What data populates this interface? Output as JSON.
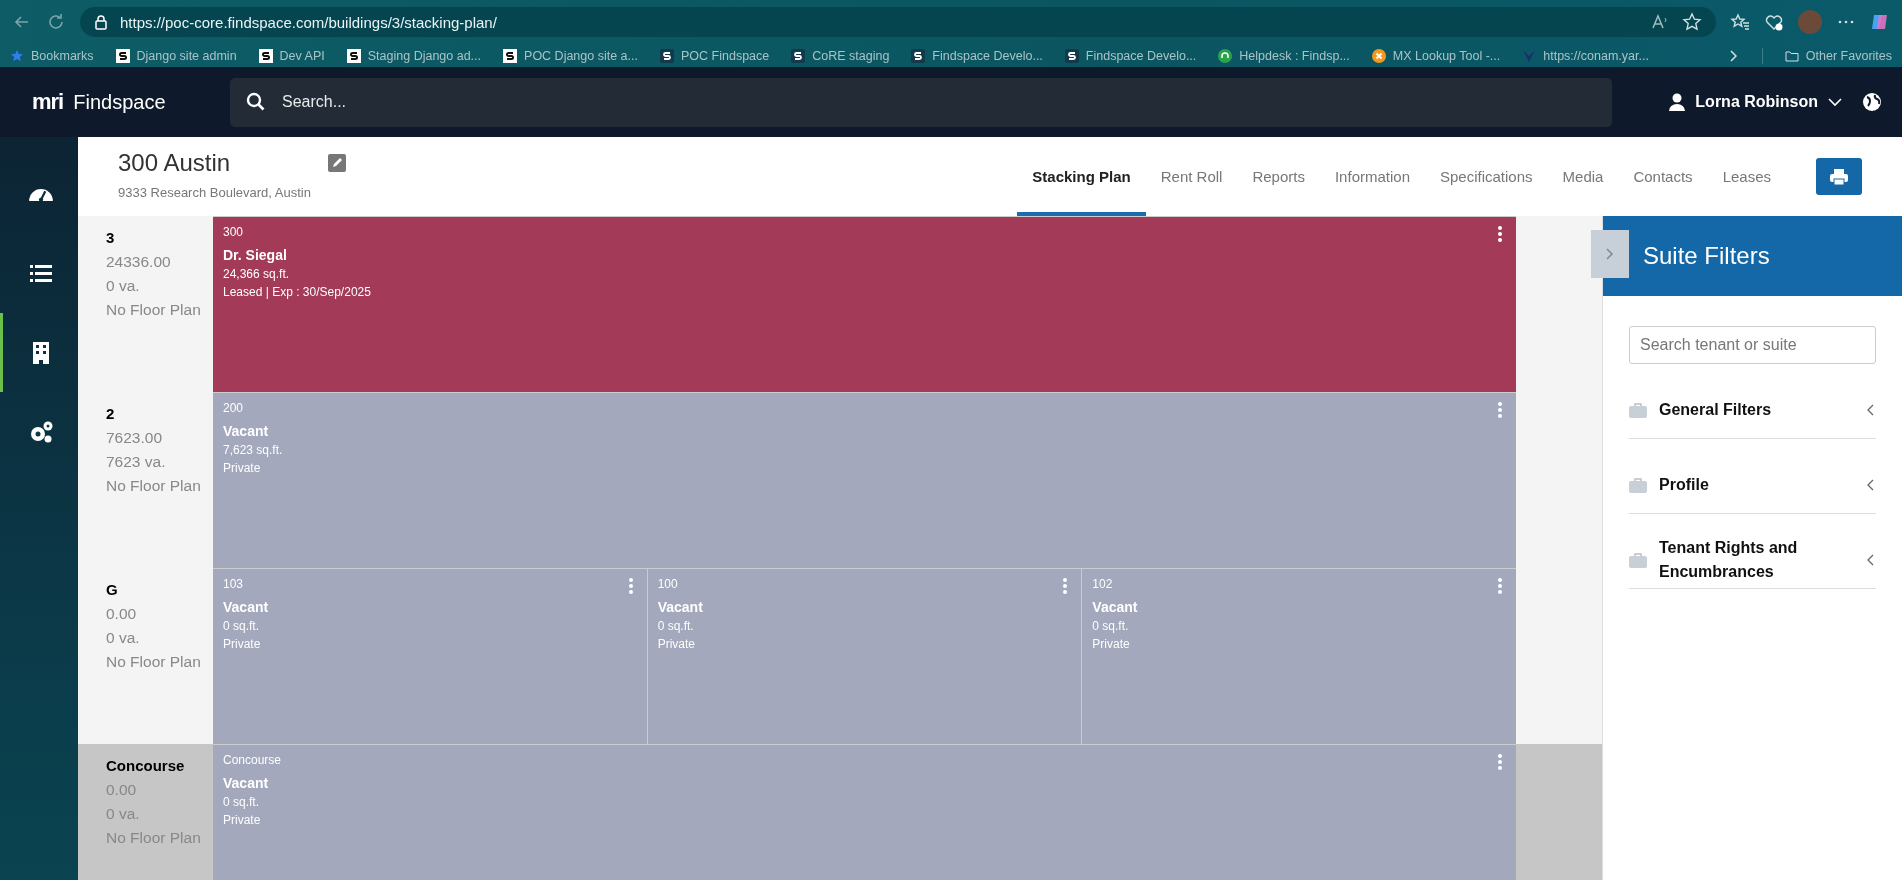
{
  "browser": {
    "url": "https://poc-core.findspace.com/buildings/3/stacking-plan/",
    "bookmarks": [
      {
        "kind": "star",
        "label": "Bookmarks"
      },
      {
        "kind": "django",
        "label": "Django site admin"
      },
      {
        "kind": "django",
        "label": "Dev API"
      },
      {
        "kind": "django",
        "label": "Staging Django ad..."
      },
      {
        "kind": "django",
        "label": "POC Django site a..."
      },
      {
        "kind": "findspace",
        "label": "POC Findspace"
      },
      {
        "kind": "findspace",
        "label": "CoRE staging"
      },
      {
        "kind": "findspace",
        "label": "Findspace Develo..."
      },
      {
        "kind": "findspace",
        "label": "Findspace Develo..."
      },
      {
        "kind": "helpdesk",
        "label": "Helpdesk : Findsp..."
      },
      {
        "kind": "mx",
        "label": "MX Lookup Tool -..."
      },
      {
        "kind": "conam",
        "label": "https://conam.yar..."
      }
    ],
    "other_favorites": "Other Favorites"
  },
  "app": {
    "logo": "mri",
    "product": "Findspace",
    "search": {
      "placeholder": "Search..."
    },
    "user": "Lorna Robinson"
  },
  "nav": [
    {
      "kind": "gauge",
      "selected": false
    },
    {
      "kind": "list",
      "selected": false
    },
    {
      "kind": "building",
      "selected": true
    },
    {
      "kind": "gears",
      "selected": false
    }
  ],
  "building": {
    "name": "300 Austin",
    "address": "9333 Research Boulevard, Austin"
  },
  "tabs": [
    {
      "label": "Stacking Plan",
      "selected": true
    },
    {
      "label": "Rent Roll",
      "selected": false
    },
    {
      "label": "Reports",
      "selected": false
    },
    {
      "label": "Information",
      "selected": false
    },
    {
      "label": "Specifications",
      "selected": false
    },
    {
      "label": "Media",
      "selected": false
    },
    {
      "label": "Contacts",
      "selected": false
    },
    {
      "label": "Leases",
      "selected": false
    }
  ],
  "floors": [
    {
      "name": "3",
      "area": "24336.00",
      "vacant_area": "0 va.",
      "floor_plan": "No Floor Plan",
      "highlighted": false,
      "suites": [
        {
          "number": "300",
          "tenant": "Dr. Siegal",
          "area": "24,366 sq.ft.",
          "status": "Leased | Exp : 30/Sep/2025",
          "color": "#a33a58"
        }
      ]
    },
    {
      "name": "2",
      "area": "7623.00",
      "vacant_area": "7623 va.",
      "floor_plan": "No Floor Plan",
      "highlighted": false,
      "suites": [
        {
          "number": "200",
          "tenant": "Vacant",
          "area": "7,623 sq.ft.",
          "status": "Private",
          "color": "#a3a8bc"
        }
      ]
    },
    {
      "name": "G",
      "area": "0.00",
      "vacant_area": "0 va.",
      "floor_plan": "No Floor Plan",
      "highlighted": false,
      "suites": [
        {
          "number": "103",
          "tenant": "Vacant",
          "area": "0 sq.ft.",
          "status": "Private",
          "color": "#a3a8bc"
        },
        {
          "number": "100",
          "tenant": "Vacant",
          "area": "0 sq.ft.",
          "status": "Private",
          "color": "#a3a8bc"
        },
        {
          "number": "102",
          "tenant": "Vacant",
          "area": "0 sq.ft.",
          "status": "Private",
          "color": "#a3a8bc"
        }
      ]
    },
    {
      "name": "Concourse",
      "area": "0.00",
      "vacant_area": "0 va.",
      "floor_plan": "No Floor Plan",
      "highlighted": true,
      "suites": [
        {
          "number": "Concourse",
          "tenant": "Vacant",
          "area": "0 sq.ft.",
          "status": "Private",
          "color": "#a3a8bc"
        }
      ]
    }
  ],
  "filters": {
    "title": "Suite Filters",
    "search": {
      "placeholder": "Search tenant or suite"
    },
    "sections": [
      {
        "label": "General Filters",
        "expanded": false
      },
      {
        "label": "Profile",
        "expanded": false
      },
      {
        "label": "Tenant Rights and Encumbrances",
        "expanded": false
      }
    ]
  }
}
